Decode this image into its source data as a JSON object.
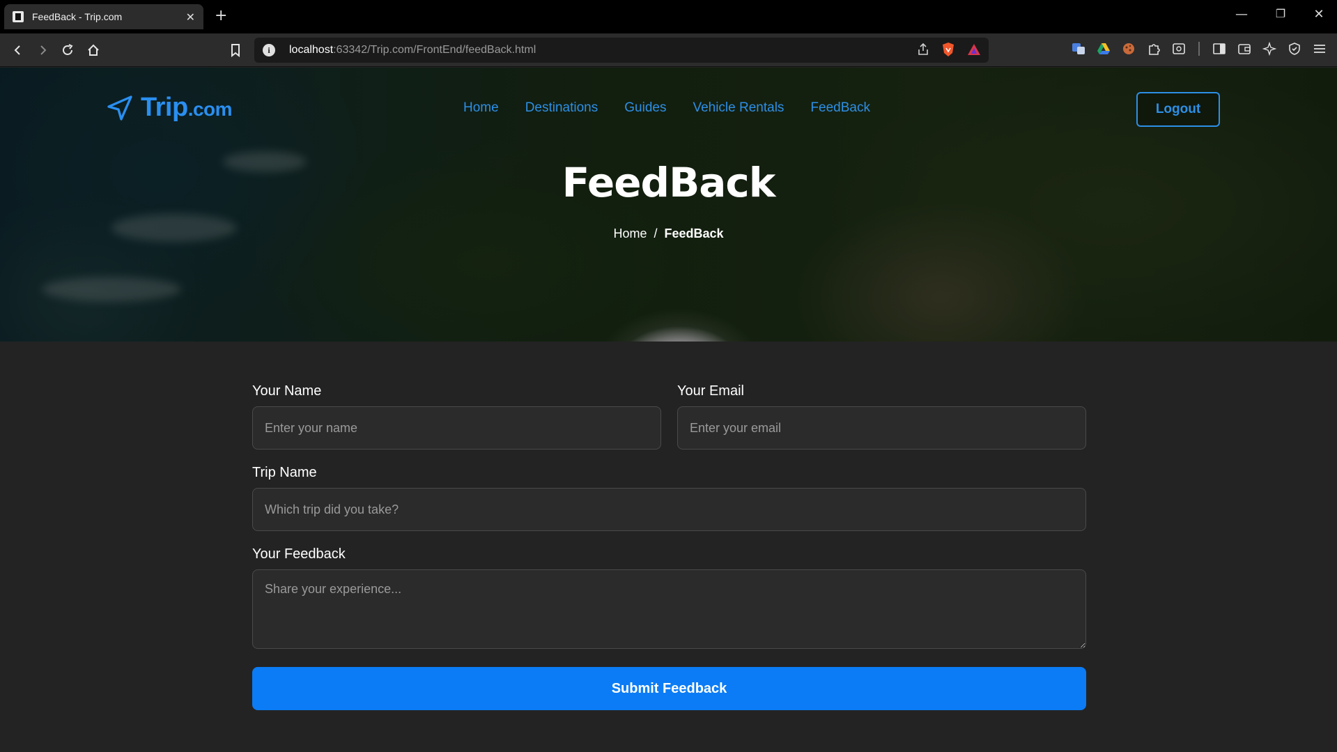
{
  "browser": {
    "tab_title": "FeedBack - Trip.com",
    "tab_close": "✕",
    "new_tab": "+",
    "url_host": "localhost",
    "url_path": ":63342/Trip.com/FrontEnd/feedBack.html",
    "window_minimize": "—",
    "window_restore": "❐",
    "window_close": "✕"
  },
  "site": {
    "logo_main": "Trip",
    "logo_suffix": ".com",
    "nav": [
      "Home",
      "Destinations",
      "Guides",
      "Vehicle Rentals",
      "FeedBack"
    ],
    "logout_label": "Logout",
    "accent_color": "#2d8fe6"
  },
  "hero": {
    "title": "FeedBack",
    "breadcrumb_home": "Home",
    "breadcrumb_sep": "/",
    "breadcrumb_current": "FeedBack"
  },
  "form": {
    "name_label": "Your Name",
    "name_placeholder": "Enter your name",
    "email_label": "Your Email",
    "email_placeholder": "Enter your email",
    "trip_label": "Trip Name",
    "trip_placeholder": "Which trip did you take?",
    "feedback_label": "Your Feedback",
    "feedback_placeholder": "Share your experience...",
    "submit_label": "Submit Feedback",
    "submit_color": "#0b7cf5"
  }
}
